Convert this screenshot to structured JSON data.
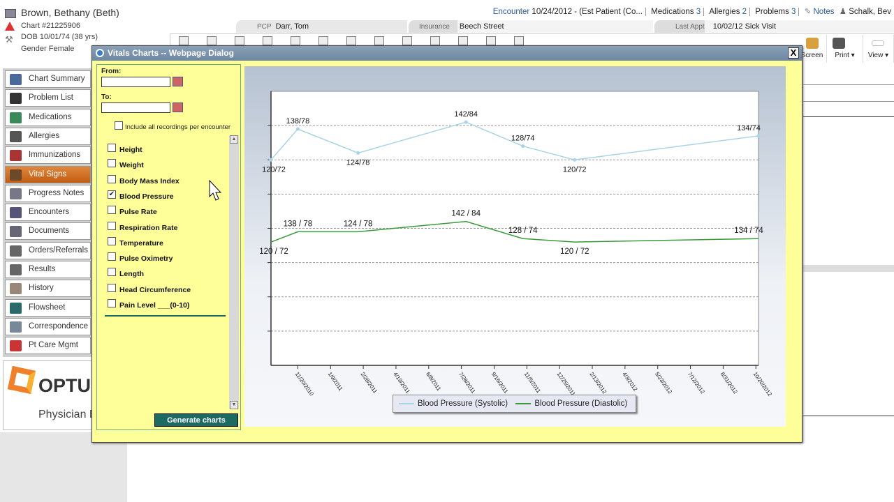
{
  "patient": {
    "name": "Brown, Bethany (Beth)",
    "chart": "Chart #21225906",
    "dob": "DOB 10/01/74 (38 yrs)",
    "gender": "Gender Female"
  },
  "banner": {
    "pcp_label": "PCP",
    "pcp": "Darr, Tom",
    "insurance_label": "Insurance",
    "insurance": "Beech Street",
    "last_appt_label": "Last Appt",
    "last_appt": "10/02/12 Sick Visit"
  },
  "topright": {
    "encounter_label": "Encounter",
    "encounter": "10/24/2012 - (Est Patient (Co...",
    "medications": "Medications",
    "medications_count": "3",
    "allergies": "Allergies",
    "allergies_count": "2",
    "problems": "Problems",
    "problems_count": "3",
    "notes": "Notes",
    "user": "Schalk, Bev"
  },
  "toolbar_right": {
    "screen": "Screen",
    "print": "Print",
    "view": "View"
  },
  "sidebar": {
    "items": [
      {
        "label": "Chart Summary",
        "color": "#4a6a9a"
      },
      {
        "label": "Problem List",
        "color": "#333"
      },
      {
        "label": "Medications",
        "color": "#3a8a5a"
      },
      {
        "label": "Allergies",
        "color": "#555"
      },
      {
        "label": "Immunizations",
        "color": "#a33"
      },
      {
        "label": "Vital Signs",
        "color": "#6a4a2a"
      },
      {
        "label": "Progress Notes",
        "color": "#778"
      },
      {
        "label": "Encounters",
        "color": "#557"
      },
      {
        "label": "Documents",
        "color": "#667"
      },
      {
        "label": "Orders/Referrals",
        "color": "#666"
      },
      {
        "label": "Results",
        "color": "#666"
      },
      {
        "label": "History",
        "color": "#987"
      },
      {
        "label": "Flowsheet",
        "color": "#2a6a6a"
      },
      {
        "label": "Correspondence",
        "color": "#789"
      },
      {
        "label": "Pt Care Mgmt",
        "color": "#c33"
      }
    ],
    "active": "Vital Signs"
  },
  "logo": {
    "brand": "OPTUM",
    "subtitle": "Physician EMR"
  },
  "dialog": {
    "title": "Vitals Charts -- Webpage Dialog",
    "close": "X",
    "from_label": "From:",
    "from_value": "",
    "to_label": "To:",
    "to_value": "",
    "include_all": "Include all recordings per encounter",
    "vitals": [
      {
        "label": "Height",
        "checked": false
      },
      {
        "label": "Weight",
        "checked": false
      },
      {
        "label": "Body Mass Index",
        "checked": false
      },
      {
        "label": "Blood Pressure",
        "checked": true
      },
      {
        "label": "Pulse Rate",
        "checked": false
      },
      {
        "label": "Respiration Rate",
        "checked": false
      },
      {
        "label": "Temperature",
        "checked": false
      },
      {
        "label": "Pulse Oximetry",
        "checked": false
      },
      {
        "label": "Length",
        "checked": false
      },
      {
        "label": "Head Circumference",
        "checked": false
      },
      {
        "label": "Pain Level ___(0-10)",
        "checked": false
      }
    ],
    "generate": "Generate charts"
  },
  "chart_data": {
    "type": "line",
    "title": "",
    "xlabel": "",
    "ylabel": "",
    "ylim": [
      0,
      160
    ],
    "grid": true,
    "legend_placement": "bottom",
    "xlim": [
      "2010-10-10",
      "2012-10-24"
    ],
    "x_ticks": [
      "11/20/2010",
      "1/9/2011",
      "2/28/2011",
      "4/19/2011",
      "6/8/2011",
      "7/28/2011",
      "9/16/2011",
      "11/5/2011",
      "12/25/2011",
      "2/13/2012",
      "4/3/2012",
      "5/23/2012",
      "7/12/2012",
      "8/31/2012",
      "10/20/2012"
    ],
    "x": [
      "2010-10-10",
      "2010-11-20",
      "2011-02-20",
      "2011-08-04",
      "2011-10-30",
      "2012-01-17",
      "2012-10-24"
    ],
    "series": [
      {
        "name": "Blood Pressure (Systolic)",
        "color": "#a8d4e6",
        "values": [
          120,
          138,
          124,
          142,
          128,
          120,
          134
        ],
        "labels": [
          "120/72",
          "138/78",
          "124/78",
          "142/84",
          "128/74",
          "120/72",
          "134/74"
        ]
      },
      {
        "name": "Blood Pressure (Diastolic)",
        "color": "#3a9a3a",
        "values": [
          72,
          78,
          78,
          84,
          74,
          72,
          74
        ],
        "labels": [
          "120 / 72",
          "138 / 78",
          "124 / 78",
          "142 / 84",
          "128 / 74",
          "120 / 72",
          "134 / 74"
        ]
      }
    ]
  }
}
